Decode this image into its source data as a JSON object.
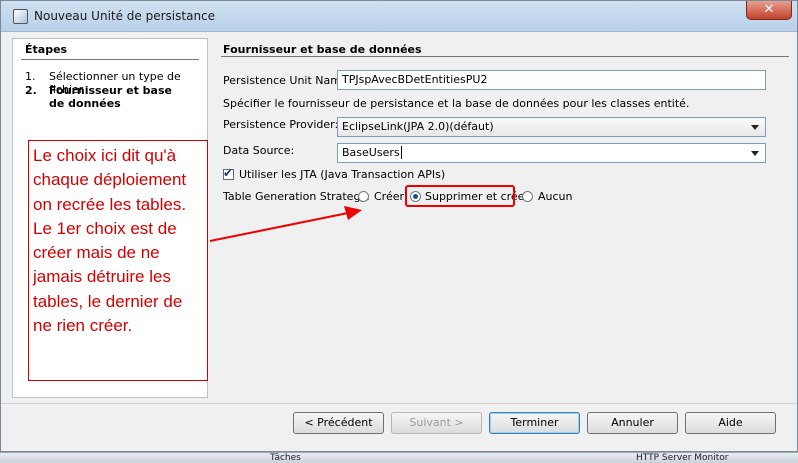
{
  "window": {
    "title": "Nouveau Unité de persistance",
    "close_label": "✕"
  },
  "steps": {
    "title": "Étapes",
    "items": [
      {
        "num": "1.",
        "label": "Sélectionner un type de fichier",
        "current": false
      },
      {
        "num": "2.",
        "label": "Fournisseur et base de données",
        "current": true
      }
    ]
  },
  "panel": {
    "title": "Fournisseur et base de données",
    "pu_name_label": "Persistence Unit Name:",
    "pu_name_value": "TPJspAvecBDetEntitiesPU2",
    "description": "Spécifier le fournisseur de persistance et la base de données pour les classes entité.",
    "provider_label": "Persistence Provider:",
    "provider_value": "EclipseLink(JPA 2.0)(défaut)",
    "datasource_label": "Data Source:",
    "datasource_value": "BaseUsers",
    "jta_label": "Utiliser les  JTA (Java Transaction APIs)",
    "jta_checked": true,
    "strategy_label": "Table Generation Strategy:",
    "strategy_options": [
      {
        "label": "Créer",
        "selected": false
      },
      {
        "label": "Supprimer et créer",
        "selected": true
      },
      {
        "label": "Aucun",
        "selected": false
      }
    ]
  },
  "annotation": {
    "text": "Le choix ici dit qu'à chaque déploiement on recrée les tables. Le 1er choix est de créer mais de ne jamais détruire les tables, le dernier de ne rien créer.",
    "color": "#d40000"
  },
  "buttons": {
    "previous": "< Précédent",
    "next": "Suivant >",
    "finish": "Terminer",
    "cancel": "Annuler",
    "help": "Aide"
  },
  "taskbar": {
    "left_label": "Tâches",
    "right_label": "HTTP Server Monitor"
  }
}
